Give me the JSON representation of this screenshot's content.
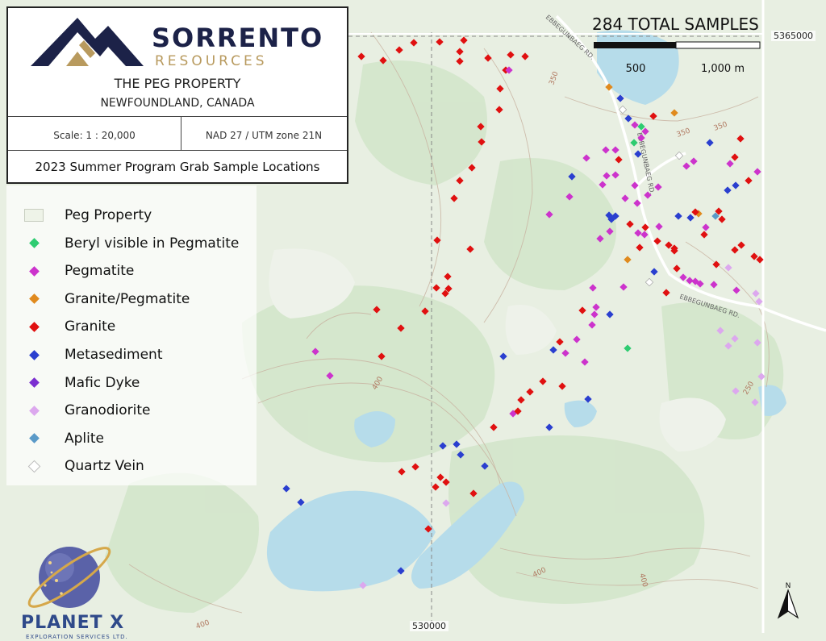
{
  "header": {
    "company_name": "SORRENTO",
    "company_sub": "RESOURCES",
    "property_name": "THE PEG PROPERTY",
    "property_location": "NEWFOUNDLAND, CANADA",
    "scale": "Scale: 1 : 20,000",
    "datum": "NAD 27 / UTM zone 21N",
    "map_title": "2023 Summer Program Grab Sample Locations"
  },
  "total_samples": "284 TOTAL SAMPLES",
  "scalebar": {
    "label_500": "500",
    "label_1000": "1,000 m"
  },
  "coordinates": {
    "northing": "5365000",
    "easting": "530000"
  },
  "roads": {
    "road_name": "EBBEGUNBAEG RD."
  },
  "contours": {
    "c350": "350",
    "c400": "400",
    "c250": "250"
  },
  "legend": [
    {
      "label": "Peg Property",
      "symbol": "polygon",
      "color": "#eef3e8"
    },
    {
      "label": "Beryl visible in Pegmatite",
      "symbol": "diamond",
      "color": "#2ecc71"
    },
    {
      "label": "Pegmatite",
      "symbol": "diamond",
      "color": "#cc33cc"
    },
    {
      "label": "Granite/Pegmatite",
      "symbol": "diamond",
      "color": "#e08a1e"
    },
    {
      "label": "Granite",
      "symbol": "diamond",
      "color": "#e01010"
    },
    {
      "label": "Metasediment",
      "symbol": "diamond",
      "color": "#2a3fcf"
    },
    {
      "label": "Mafic Dyke",
      "symbol": "diamond",
      "color": "#7b2fd0"
    },
    {
      "label": "Granodiorite",
      "symbol": "diamond",
      "color": "#dca8ee"
    },
    {
      "label": "Aplite",
      "symbol": "diamond",
      "color": "#5a9ac8"
    },
    {
      "label": "Quartz Vein",
      "symbol": "diamond",
      "color": "#ffffff"
    }
  ],
  "logo2": {
    "name": "PLANET X",
    "sub": "EXPLORATION SERVICES LTD."
  },
  "north": {
    "label": "N"
  },
  "colors": {
    "water": "#b6dcea",
    "land": "#e6eee0",
    "forest": "#cfe3c6"
  }
}
